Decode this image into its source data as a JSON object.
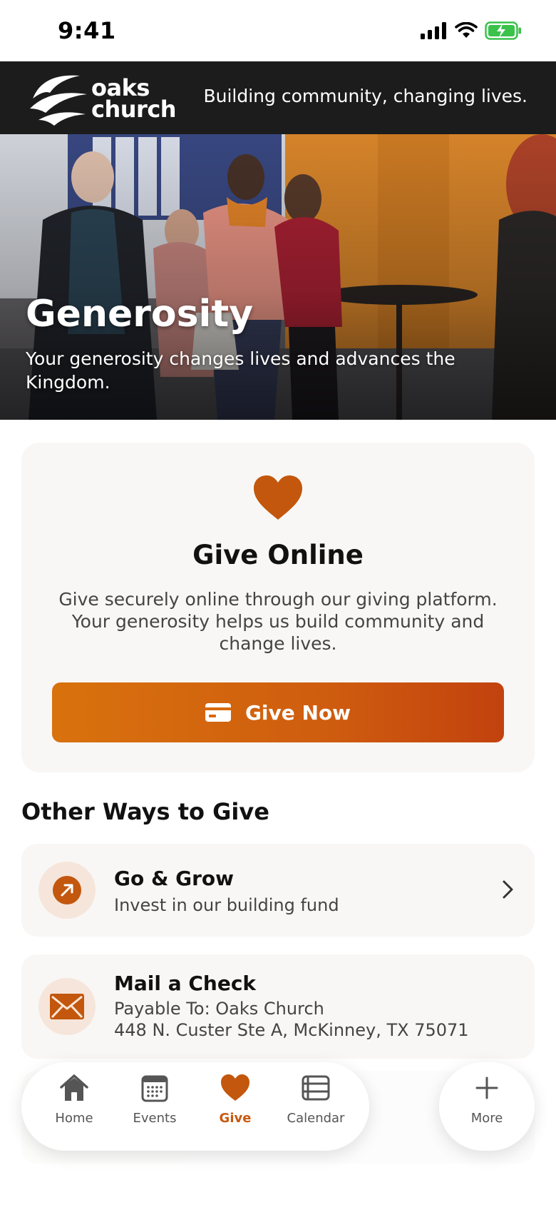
{
  "status_bar": {
    "time": "9:41"
  },
  "header": {
    "logo_text_line1": "oaks",
    "logo_text_line2": "church",
    "tagline": "Building community, changing lives."
  },
  "hero": {
    "title": "Generosity",
    "subtitle": "Your generosity changes lives and advances the Kingdom."
  },
  "give_online": {
    "icon": "heart-icon",
    "title": "Give Online",
    "description": "Give securely online through our giving platform. Your generosity helps us build community and change lives.",
    "button_label": "Give Now",
    "button_icon": "credit-card-icon"
  },
  "other_ways": {
    "title": "Other Ways to Give",
    "items": [
      {
        "icon": "arrow-up-right-icon",
        "title": "Go & Grow",
        "subtitle": "Invest in our building fund"
      },
      {
        "icon": "envelope-icon",
        "title": "Mail a Check",
        "line1": "Payable To: Oaks Church",
        "line2": "448 N. Custer Ste A, McKinney, TX 75071"
      }
    ]
  },
  "tabbar": {
    "tabs": [
      {
        "label": "Home",
        "icon": "home-icon"
      },
      {
        "label": "Events",
        "icon": "calendar-grid-icon"
      },
      {
        "label": "Give",
        "icon": "heart-icon",
        "active": true
      },
      {
        "label": "Calendar",
        "icon": "list-calendar-icon"
      }
    ],
    "more_label": "More"
  },
  "colors": {
    "accent": "#c75a10",
    "header_bg": "#1c1c1c",
    "card_bg": "#f9f7f5"
  }
}
